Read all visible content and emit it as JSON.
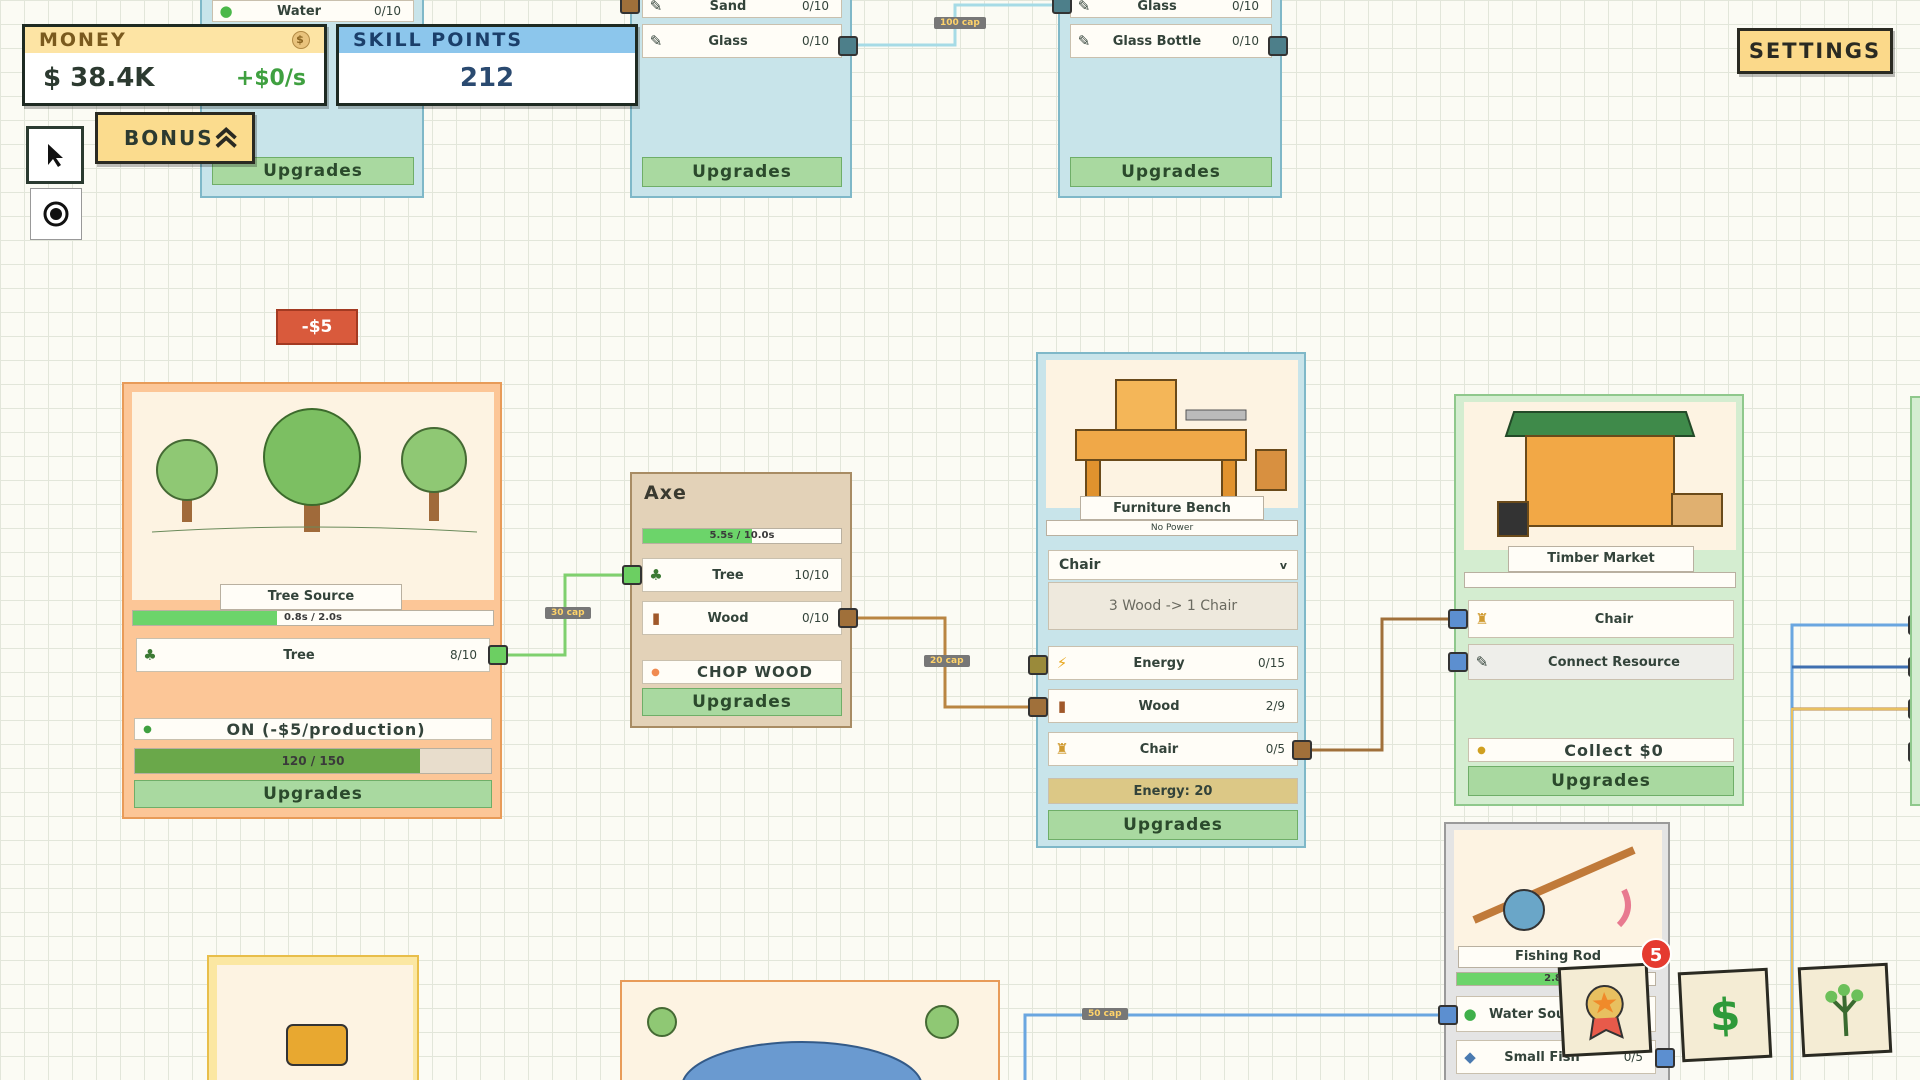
{
  "hud": {
    "money_label": "MONEY",
    "money_value": "$ 38.4K",
    "money_rate": "+$0/s",
    "skill_label": "SKILL POINTS",
    "skill_value": "212",
    "settings_label": "SETTINGS",
    "bonus_label": "BONUS"
  },
  "floating": {
    "cost_popup": "-$5"
  },
  "top_cards": {
    "left": {
      "row_label": "Water",
      "row_count": "0/10",
      "upgrades": "Upgrades"
    },
    "middle": {
      "row1_label": "Sand",
      "row1_count": "0/10",
      "row2_label": "Glass",
      "row2_count": "0/10",
      "upgrades": "Upgrades"
    },
    "right": {
      "row1_label": "Glass",
      "row1_count": "0/10",
      "row2_label": "Glass Bottle",
      "row2_count": "0/10",
      "upgrades": "Upgrades"
    },
    "cap": "100 cap"
  },
  "tree_source": {
    "title": "Tree Source",
    "progress_text": "0.8s / 2.0s",
    "progress_fraction": 0.4,
    "row_label": "Tree",
    "row_count": "8/10",
    "toggle_label": "ON (-$5/production)",
    "capacity_text": "120 / 150",
    "capacity_fraction": 0.8,
    "upgrades": "Upgrades",
    "cap": "30 cap"
  },
  "axe": {
    "title": "Axe",
    "progress_text": "5.5s / 10.0s",
    "progress_fraction": 0.55,
    "row1_label": "Tree",
    "row1_count": "10/10",
    "row2_label": "Wood",
    "row2_count": "0/10",
    "action_label": "CHOP WOOD",
    "upgrades": "Upgrades",
    "cap": "20 cap"
  },
  "furniture_bench": {
    "title": "Furniture Bench",
    "status": "No Power",
    "recipe_select": "Chair",
    "recipe_text": "3 Wood -> 1 Chair",
    "row1_label": "Energy",
    "row1_count": "0/15",
    "row2_label": "Wood",
    "row2_count": "2/9",
    "row3_label": "Chair",
    "row3_count": "0/5",
    "energy_text": "Energy: 20",
    "upgrades": "Upgrades"
  },
  "timber_market": {
    "title": "Timber Market",
    "row1_label": "Chair",
    "row2_label": "Connect Resource",
    "collect_label": "Collect $0",
    "upgrades": "Upgrades"
  },
  "fishing_rod": {
    "title": "Fishing Rod",
    "progress_text": "2.8s",
    "progress_fraction": 0.6,
    "row1_label": "Water Source",
    "row2_label": "Small Fish",
    "row2_count": "0/5",
    "cap": "50 cap"
  },
  "bottom_buttons": {
    "achievements_badge": "5"
  },
  "colors": {
    "port_green": "#6ccf62",
    "port_brown": "#a0703a",
    "port_blue": "#5c8fd0",
    "port_teal": "#4d7f8a",
    "wire_brown": "#b98542",
    "wire_green": "#7fd06e",
    "wire_blue": "#6aa6e0"
  }
}
